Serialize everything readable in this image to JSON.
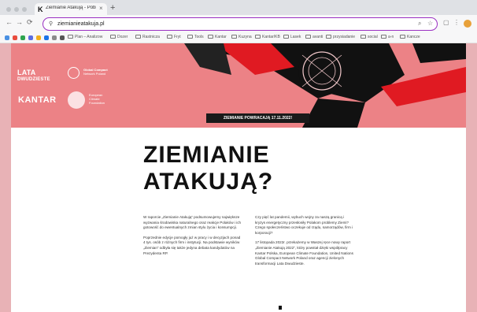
{
  "browser": {
    "tab_title": "Ziemianie Atakują - Pobierz",
    "tab_favicon": "K",
    "tab_close": "×",
    "new_tab": "+",
    "url": "ziemianieatakuja.pl",
    "nav": {
      "back": "←",
      "forward": "→",
      "reload": "⟳"
    },
    "icons": [
      "lock-icon",
      "zoom-icon",
      "star-icon",
      "extensions-icon",
      "menu-icon"
    ]
  },
  "bookmarks": [
    "Plan – Analizow",
    "Dozer",
    "Rastnicza",
    "Fryt",
    "Tools",
    "Kantar",
    "Kuzyna",
    "Kantar/KB",
    "Lasek",
    "avanti",
    "przysiadanie",
    "social",
    "a-n",
    "Kancze"
  ],
  "hero": {
    "logo_lata_line1": "LATA",
    "logo_lata_line2": "DWUDZIESTE",
    "logo_kantar": "KANTAR",
    "logo_gcnp_line1": "Global Compact",
    "logo_gcnp_line2": "Network Poland",
    "logo_ecf_line1": "European",
    "logo_ecf_line2": "Climate",
    "logo_ecf_line3": "Foundation",
    "banner": "ZIEMIANIE POWRACAJĄ 17.11.2022!",
    "colors": {
      "background": "#ec8286",
      "poster_red": "#e01a22",
      "poster_black": "#111111"
    }
  },
  "article": {
    "title_line1": "ZIEMIANIE",
    "title_line2": "ATAKUJĄ?",
    "col1_p1": "W raporcie „Ziemianie Atakują” podsumowujemy największe wyzwania środowiska naturalnego oraz reakcje Polaków i ich gotowość do ewentualnych zmian stylu życia i konsumpcji.",
    "col1_p2": "Poprzednie edycje pomogły już w pracy i w decyzjach ponad 4 tys. osób z różnych firm i instytucji. Na podstawie wyników „Ziemian” odbyła się także jedyna debata kandydatów na Prezydenta RP.",
    "col2_p1": "Czy pięć lat pandemii, wybuch wojny za naszą granicą i kryzys energetyczny przesłoniły Polakom problemy Ziemi? Czego społeczeństwo oczekuje od rządu, samorządów, firm i korporacji?",
    "col2_p2": "17 listopada 2022r. przekażemy w Waszej ręce nowy raport „Ziemianie Atakują 2022”, który powstał dzięki współpracy Kantar Polska, European Climate Foundation, United Nations Global Compact Network Poland oraz agencji zielonych transformacji Lata Dwudzieste."
  }
}
